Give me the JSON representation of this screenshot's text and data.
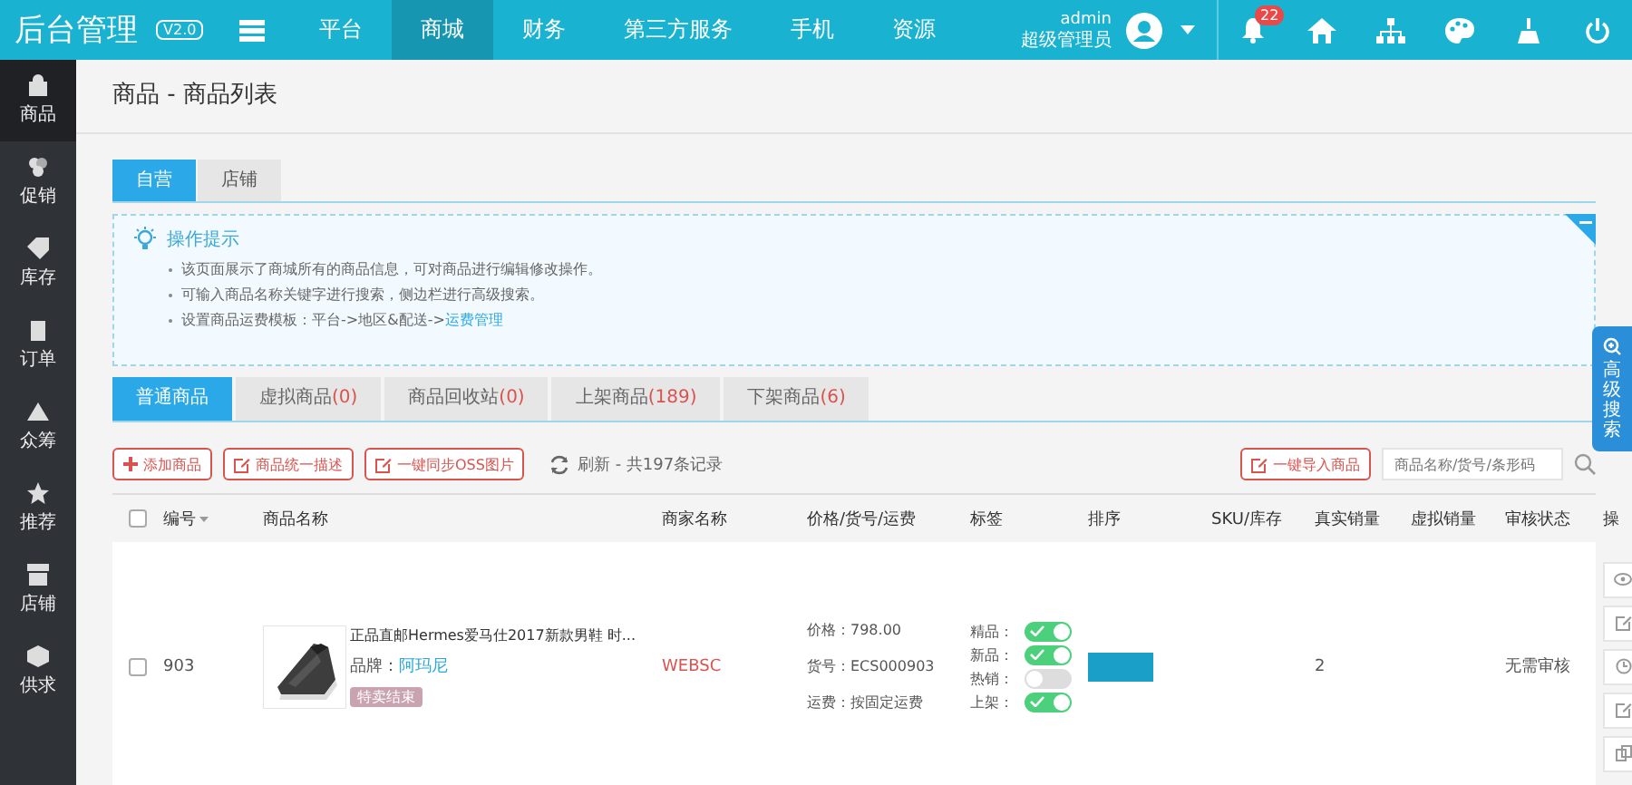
{
  "topbar": {
    "logo": "后台管理",
    "version": "V2.0",
    "nav": [
      {
        "label": "平台",
        "selected": false
      },
      {
        "label": "商城",
        "selected": true
      },
      {
        "label": "财务",
        "selected": false
      },
      {
        "label": "第三方服务",
        "selected": false
      },
      {
        "label": "手机",
        "selected": false
      },
      {
        "label": "资源",
        "selected": false
      }
    ],
    "user": {
      "name": "admin",
      "role": "超级管理员"
    },
    "notifications": "22"
  },
  "sidebar": [
    {
      "label": "商品",
      "selected": true
    },
    {
      "label": "促销",
      "selected": false
    },
    {
      "label": "库存",
      "selected": false
    },
    {
      "label": "订单",
      "selected": false
    },
    {
      "label": "众筹",
      "selected": false
    },
    {
      "label": "推荐",
      "selected": false
    },
    {
      "label": "店铺",
      "selected": false
    },
    {
      "label": "供求",
      "selected": false
    }
  ],
  "breadcrumb": "商品 - 商品列表",
  "scope_tabs": [
    {
      "label": "自营",
      "selected": true
    },
    {
      "label": "店铺",
      "selected": false
    }
  ],
  "tips": {
    "title": "操作提示",
    "items": [
      [
        {
          "text": "该页面展示了商城所有的商品信息，可对商品进行编辑修改操作。"
        }
      ],
      [
        {
          "text": "可输入商品名称关键字进行搜索，侧边栏进行高级搜索。"
        }
      ],
      [
        {
          "text": "设置商品运费模板：平台->地区&配送->"
        },
        {
          "text": "运费管理",
          "link": true
        }
      ]
    ]
  },
  "product_tabs": [
    {
      "label": "普通商品",
      "selected": true
    },
    {
      "label": "虚拟商品",
      "count": "(0)",
      "selected": false
    },
    {
      "label": "商品回收站",
      "count": "(0)",
      "selected": false
    },
    {
      "label": "上架商品",
      "count": "(189)",
      "selected": false
    },
    {
      "label": "下架商品",
      "count": "(6)",
      "selected": false
    }
  ],
  "toolbar": {
    "buttons": [
      {
        "label": "添加商品",
        "kind": "add"
      },
      {
        "label": "商品统一描述",
        "kind": "edit"
      },
      {
        "label": "一键同步OSS图片",
        "kind": "edit"
      }
    ],
    "refresh": "刷新 - 共197条记录",
    "import": "一键导入商品",
    "search": {
      "placeholder": "商品名称/货号/条形码"
    }
  },
  "advanced_search": "高级搜索",
  "table": {
    "columns": [
      "编号",
      "商品名称",
      "商家名称",
      "价格/货号/运费",
      "标签",
      "排序",
      "SKU/库存",
      "真实销量",
      "虚拟销量",
      "审核状态",
      "操"
    ],
    "select_all": false,
    "rows": [
      {
        "checked": false,
        "id": "903",
        "name": "正品直邮Hermes爱马仕2017新款男鞋 时...",
        "brand_label": "品牌：",
        "brand": "阿玛尼",
        "badge": "特卖结束",
        "merchant": "WEBSC",
        "price": "价格：798.00",
        "sn": "货号：ECS000903",
        "shipping": "运费：按固定运费",
        "tags": [
          {
            "label": "精品：",
            "on": true
          },
          {
            "label": "新品：",
            "on": true
          },
          {
            "label": "热销：",
            "on": false
          },
          {
            "label": "上架：",
            "on": true
          }
        ],
        "real_sales": "2",
        "review": "无需审核"
      }
    ]
  }
}
